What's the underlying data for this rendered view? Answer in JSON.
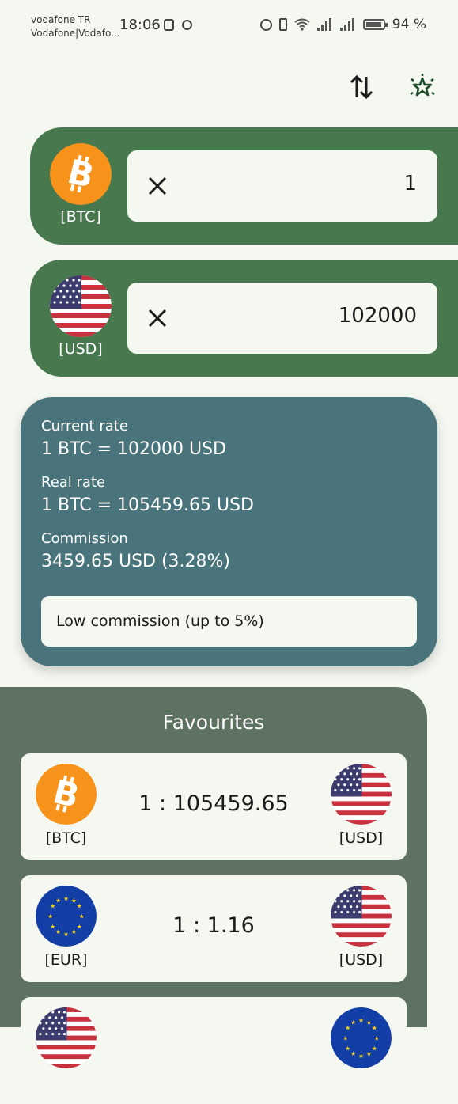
{
  "status_bar": {
    "carrier_line1": "vodafone TR",
    "carrier_line2": "Vodafone|Vodafo...",
    "time": "18:06",
    "battery": "94 %"
  },
  "toolbar": {
    "swap_icon": "swap-vertical-icon",
    "favourite_icon": "star-sparkle-icon"
  },
  "from": {
    "code": "[BTC]",
    "value": "1",
    "icon": "bitcoin-icon"
  },
  "to": {
    "code": "[USD]",
    "value": "102000",
    "icon": "us-flag-icon"
  },
  "rates": {
    "current_label": "Current rate",
    "current_value": "1 BTC = 102000 USD",
    "real_label": "Real rate",
    "real_value": "1 BTC = 105459.65 USD",
    "commission_label": "Commission",
    "commission_value": "3459.65 USD (3.28%)",
    "commission_level": "Low commission (up to 5%)"
  },
  "favourites": {
    "title": "Favourites",
    "items": [
      {
        "from_code": "[BTC]",
        "to_code": "[USD]",
        "rate": "1 : 105459.65"
      },
      {
        "from_code": "[EUR]",
        "to_code": "[USD]",
        "rate": "1 : 1.16"
      }
    ]
  },
  "colors": {
    "background": "#f5f8f1",
    "converter_card": "#48794e",
    "rate_card": "#4a747b",
    "favourites_panel": "#5d7260",
    "bitcoin_orange": "#f7931a"
  }
}
